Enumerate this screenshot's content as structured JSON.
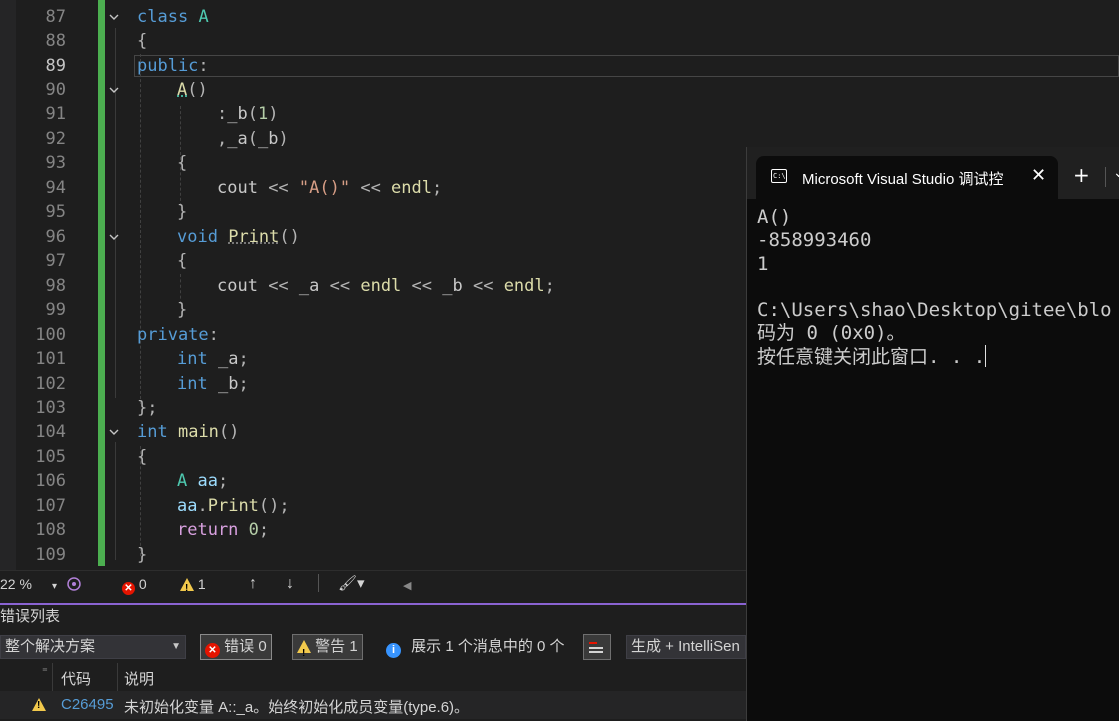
{
  "editor": {
    "line_numbers": [
      "87",
      "88",
      "89",
      "90",
      "91",
      "92",
      "93",
      "94",
      "95",
      "96",
      "97",
      "98",
      "99",
      "100",
      "101",
      "102",
      "103",
      "104",
      "105",
      "106",
      "107",
      "108",
      "109"
    ],
    "code": {
      "l87_kw": "class",
      "l87_cls": "A",
      "l88": "{",
      "l89_kw": "public",
      "l89_p": ":",
      "l90_fn": "A",
      "l90_p": "()",
      "l91_p1": ":",
      "l91_var": "_b",
      "l91_p2": "(",
      "l91_num": "1",
      "l91_p3": ")",
      "l92_p1": ",",
      "l92_var1": "_a",
      "l92_p2": "(",
      "l92_var2": "_b",
      "l92_p3": ")",
      "l93": "{",
      "l94_id": "cout",
      "l94_op1": " << ",
      "l94_str": "\"A()\"",
      "l94_op2": " << ",
      "l94_endl": "endl",
      "l94_p": ";",
      "l95": "}",
      "l96_kw": "void",
      "l96_fn": "Print",
      "l96_p": "()",
      "l97": "{",
      "l98_id": "cout",
      "l98_op1": " << ",
      "l98_v1": "_a",
      "l98_op2": " << ",
      "l98_e1": "endl",
      "l98_op3": " << ",
      "l98_v2": "_b",
      "l98_op4": " << ",
      "l98_e2": "endl",
      "l98_p": ";",
      "l99": "}",
      "l100_kw": "private",
      "l100_p": ":",
      "l101_kw": "int",
      "l101_var": "_a",
      "l101_p": ";",
      "l102_kw": "int",
      "l102_var": "_b",
      "l102_p": ";",
      "l103": "};",
      "l104_kw": "int",
      "l104_fn": "main",
      "l104_p": "()",
      "l105": "{",
      "l106_cls": "A",
      "l106_var": "aa",
      "l106_p": ";",
      "l107_var": "aa",
      "l107_dot": ".",
      "l107_fn": "Print",
      "l107_p": "();",
      "l108_kw": "return",
      "l108_num": "0",
      "l108_p": ";",
      "l109": "}"
    }
  },
  "statusbar": {
    "zoom": "22 %",
    "errors": "0",
    "warnings": "1"
  },
  "error_list": {
    "title": "错误列表",
    "scope_dropdown": "整个解决方案",
    "errors_chip": "错误 0",
    "warnings_chip": "警告 1",
    "messages_text": "展示 1 个消息中的 0 个",
    "build_dropdown": "生成 + IntelliSen",
    "columns": {
      "code": "代码",
      "description": "说明"
    },
    "rows": [
      {
        "code": "C26495",
        "description": "未初始化变量 A::_a。始终初始化成员变量(type.6)。"
      }
    ]
  },
  "console": {
    "tab_title": "Microsoft Visual Studio 调试控",
    "icon_text": "C:\\",
    "output_lines": [
      "A()",
      "-858993460",
      "1",
      "",
      "C:\\Users\\shao\\Desktop\\gitee\\blo",
      "码为 0 (0x0)。",
      "按任意键关闭此窗口. . ."
    ]
  }
}
